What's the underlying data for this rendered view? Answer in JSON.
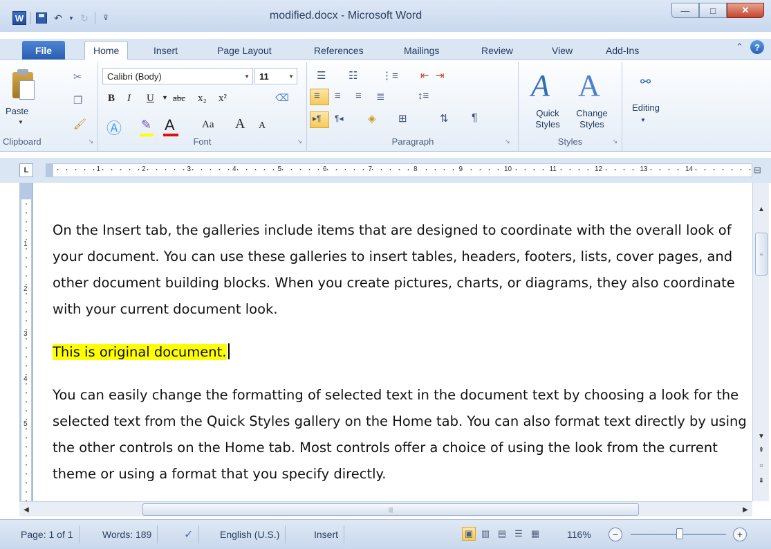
{
  "window": {
    "title": "modified.docx - Microsoft Word",
    "logo_letter": "W",
    "minimize_glyph": "—",
    "maximize_glyph": "□",
    "close_glyph": "✕"
  },
  "ribbon_tabs": {
    "file": "File",
    "home": "Home",
    "insert": "Insert",
    "page_layout": "Page Layout",
    "references": "References",
    "mailings": "Mailings",
    "review": "Review",
    "view": "View",
    "addins": "Add-Ins"
  },
  "clipboard": {
    "label": "Clipboard",
    "paste": "Paste"
  },
  "font": {
    "label": "Font",
    "name": "Calibri (Body)",
    "size": "11",
    "bold": "B",
    "italic": "I",
    "underline": "U",
    "strikethrough": "abc",
    "subscript": "x₂",
    "superscript": "x²",
    "change_case": "Aa",
    "grow": "A",
    "shrink": "A",
    "font_color_letter": "A"
  },
  "paragraph": {
    "label": "Paragraph",
    "pilcrow": "¶"
  },
  "styles": {
    "label": "Styles",
    "quick": "Quick\nStyles",
    "change": "Change\nStyles"
  },
  "editing": {
    "label": "Editing"
  },
  "ruler": {
    "numbers": [
      "1",
      "2",
      "3",
      "4",
      "5",
      "6",
      "7",
      "8",
      "9",
      "10",
      "11",
      "12",
      "13",
      "14"
    ],
    "tab_selector": "L"
  },
  "vertical_ruler": {
    "numbers": [
      "1",
      "2",
      "3",
      "4",
      "5"
    ]
  },
  "document": {
    "paragraph1": "On the Insert tab, the galleries include items that are designed to coordinate with the overall look of your document. You can use these galleries to insert tables, headers, footers, lists, cover pages, and other document building blocks. When you create pictures, charts, or diagrams, they also coordinate with your current document look.",
    "highlighted": "This is original document.",
    "paragraph2": "You can easily change the formatting of selected text in the document text by choosing a look for the selected text from the Quick Styles gallery on the Home tab. You can also format text directly by using the other controls on the Home tab. Most controls offer a choice of using the look from the current theme or using a format that you specify directly."
  },
  "statusbar": {
    "page": "Page: 1 of 1",
    "words": "Words: 189",
    "language": "English (U.S.)",
    "mode": "Insert",
    "zoom": "116%",
    "zoom_out": "−",
    "zoom_in": "+"
  },
  "colors": {
    "highlight": "#ffff00",
    "accent": "#2a5db0",
    "font_color": "#e01010"
  }
}
